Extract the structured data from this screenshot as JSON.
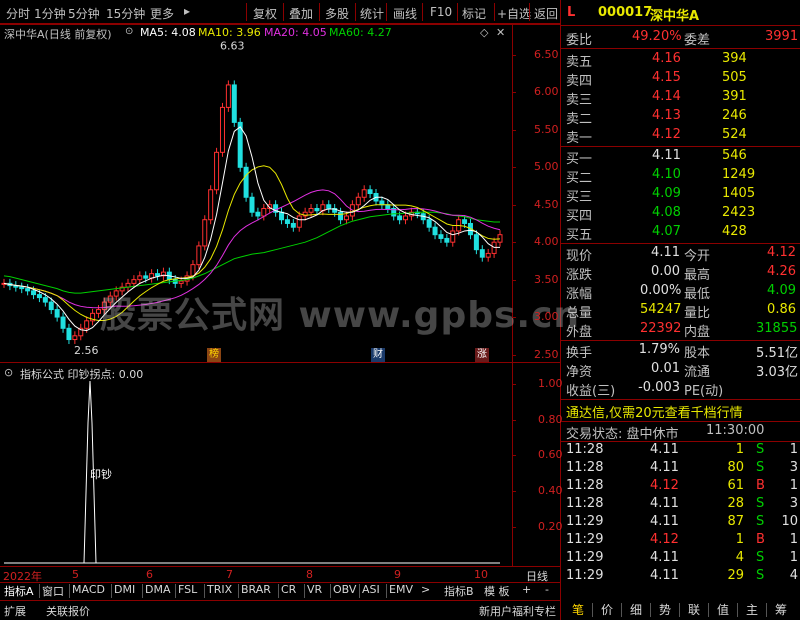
{
  "toolbar": {
    "periods": [
      "分时",
      "1分钟",
      "5分钟",
      "15分钟",
      "更多"
    ],
    "more_arrow": "▸",
    "buttons": [
      "复权",
      "叠加",
      "多股",
      "统计",
      "画线",
      "F10",
      "标记",
      "+自选",
      "返回"
    ]
  },
  "chart": {
    "title": "深中华A(日线 前复权)",
    "ma5": "MA5: 4.08",
    "ma10": "MA10: 3.96",
    "ma20": "MA20: 4.05",
    "ma60": "MA60: 4.27",
    "y_ticks": [
      "6.50",
      "6.00",
      "5.50",
      "5.00",
      "4.50",
      "4.00",
      "3.50",
      "3.00",
      "2.50"
    ],
    "high_label": "6.63",
    "low_label": "2.56",
    "markers": [
      "榜",
      "财",
      "涨"
    ],
    "colors": {
      "up": "#ff3030",
      "down": "#20e0e0",
      "ma5": "#ffffff",
      "ma10": "#e8e800",
      "ma20": "#e030e0",
      "ma60": "#00d000"
    }
  },
  "indicator": {
    "title": "指标公式  印钞拐点: 0.00",
    "y_ticks": [
      "1.00",
      "0.80",
      "0.60",
      "0.40",
      "0.20"
    ],
    "signal_label": "印钞"
  },
  "time_axis": {
    "labels": [
      "2022年",
      "5",
      "6",
      "7",
      "8",
      "9",
      "10"
    ],
    "period": "日线"
  },
  "tabs": {
    "items": [
      "指标A",
      "窗口",
      "MACD",
      "DMI",
      "DMA",
      "FSL",
      "TRIX",
      "BRAR",
      "CR",
      "VR",
      "OBV",
      "ASI",
      "EMV"
    ],
    "more": ">",
    "right": [
      "指标B",
      "模 板",
      "+",
      "-"
    ]
  },
  "bottom": {
    "left": [
      "扩展",
      "关联报价"
    ],
    "right": "新用户福利专栏",
    "nav": [
      "笔",
      "价",
      "细",
      "势",
      "联",
      "值",
      "主",
      "筹"
    ]
  },
  "quote": {
    "flag": "L",
    "code": "000017",
    "name": "深中华A",
    "weibi_label": "委比",
    "weibi": "49.20%",
    "weicha_label": "委差",
    "weicha": "3991",
    "sells": [
      {
        "label": "卖五",
        "price": "4.16",
        "vol": "394"
      },
      {
        "label": "卖四",
        "price": "4.15",
        "vol": "505"
      },
      {
        "label": "卖三",
        "price": "4.14",
        "vol": "391"
      },
      {
        "label": "卖二",
        "price": "4.13",
        "vol": "246"
      },
      {
        "label": "卖一",
        "price": "4.12",
        "vol": "524"
      }
    ],
    "buys": [
      {
        "label": "买一",
        "price": "4.11",
        "vol": "546"
      },
      {
        "label": "买二",
        "price": "4.10",
        "vol": "1249"
      },
      {
        "label": "买三",
        "price": "4.09",
        "vol": "1405"
      },
      {
        "label": "买四",
        "price": "4.08",
        "vol": "2423"
      },
      {
        "label": "买五",
        "price": "4.07",
        "vol": "428"
      }
    ],
    "stats": [
      {
        "l1": "现价",
        "v1": "4.11",
        "l2": "今开",
        "v2": "4.12"
      },
      {
        "l1": "涨跌",
        "v1": "0.00",
        "l2": "最高",
        "v2": "4.26"
      },
      {
        "l1": "涨幅",
        "v1": "0.00%",
        "l2": "最低",
        "v2": "4.09"
      },
      {
        "l1": "总量",
        "v1": "54247",
        "l2": "量比",
        "v2": "0.86"
      },
      {
        "l1": "外盘",
        "v1": "22392",
        "l2": "内盘",
        "v2": "31855"
      }
    ],
    "stats2": [
      {
        "l1": "换手",
        "v1": "1.79%",
        "l2": "股本",
        "v2": "5.51亿"
      },
      {
        "l1": "净资",
        "v1": "0.01",
        "l2": "流通",
        "v2": "3.03亿"
      },
      {
        "l1": "收益(三)",
        "v1": "-0.003",
        "l2": "PE(动)",
        "v2": ""
      }
    ],
    "promo": "通达信,仅需20元查看千档行情",
    "status_label": "交易状态: 盘中休市",
    "status_time": "11:30:00",
    "ticks": [
      {
        "t": "11:28",
        "p": "4.11",
        "v": "1",
        "s": "S",
        "n": "1"
      },
      {
        "t": "11:28",
        "p": "4.11",
        "v": "80",
        "s": "S",
        "n": "3"
      },
      {
        "t": "11:28",
        "p": "4.12",
        "v": "61",
        "s": "B",
        "n": "1"
      },
      {
        "t": "11:28",
        "p": "4.11",
        "v": "28",
        "s": "S",
        "n": "3"
      },
      {
        "t": "11:29",
        "p": "4.11",
        "v": "87",
        "s": "S",
        "n": "10"
      },
      {
        "t": "11:29",
        "p": "4.12",
        "v": "1",
        "s": "B",
        "n": "1"
      },
      {
        "t": "11:29",
        "p": "4.11",
        "v": "4",
        "s": "S",
        "n": "1"
      },
      {
        "t": "11:29",
        "p": "4.11",
        "v": "29",
        "s": "S",
        "n": "4"
      }
    ]
  },
  "watermark": "股票公式网  www.gpbs.cn",
  "series": {
    "close": [
      3.45,
      3.42,
      3.4,
      3.38,
      3.35,
      3.3,
      3.26,
      3.2,
      3.1,
      3.0,
      2.85,
      2.7,
      2.75,
      2.85,
      2.95,
      3.05,
      3.1,
      3.2,
      3.28,
      3.35,
      3.4,
      3.45,
      3.5,
      3.55,
      3.52,
      3.58,
      3.55,
      3.6,
      3.5,
      3.45,
      3.48,
      3.55,
      3.7,
      3.95,
      4.3,
      4.7,
      5.2,
      5.8,
      6.1,
      5.6,
      5.0,
      4.6,
      4.4,
      4.35,
      4.45,
      4.5,
      4.4,
      4.3,
      4.25,
      4.2,
      4.35,
      4.4,
      4.45,
      4.42,
      4.5,
      4.45,
      4.4,
      4.3,
      4.35,
      4.5,
      4.6,
      4.7,
      4.65,
      4.55,
      4.5,
      4.45,
      4.35,
      4.3,
      4.35,
      4.4,
      4.38,
      4.3,
      4.2,
      4.1,
      4.05,
      4.0,
      4.15,
      4.3,
      4.25,
      4.1,
      3.9,
      3.8,
      3.85,
      4.0,
      4.1
    ],
    "ma60": [
      3.55,
      3.54,
      3.52,
      3.5,
      3.48,
      3.46,
      3.44,
      3.42,
      3.4,
      3.38,
      3.35,
      3.33,
      3.32,
      3.32,
      3.33,
      3.34,
      3.35,
      3.36,
      3.37,
      3.38,
      3.39,
      3.4,
      3.41,
      3.42,
      3.43,
      3.44,
      3.45,
      3.46,
      3.47,
      3.48,
      3.49,
      3.5,
      3.52,
      3.55,
      3.58,
      3.62,
      3.66,
      3.7,
      3.74,
      3.78,
      3.8,
      3.82,
      3.84,
      3.85,
      3.86,
      3.88,
      3.9,
      3.92,
      3.94,
      3.96,
      3.98,
      4.0,
      4.03,
      4.06,
      4.1,
      4.14,
      4.18,
      4.22,
      4.25,
      4.28,
      4.3,
      4.32,
      4.34,
      4.35,
      4.36,
      4.37,
      4.38,
      4.38,
      4.39,
      4.39,
      4.4,
      4.4,
      4.4,
      4.4,
      4.39,
      4.38,
      4.36,
      4.35,
      4.34,
      4.32,
      4.3,
      4.29,
      4.28,
      4.27,
      4.27
    ]
  }
}
